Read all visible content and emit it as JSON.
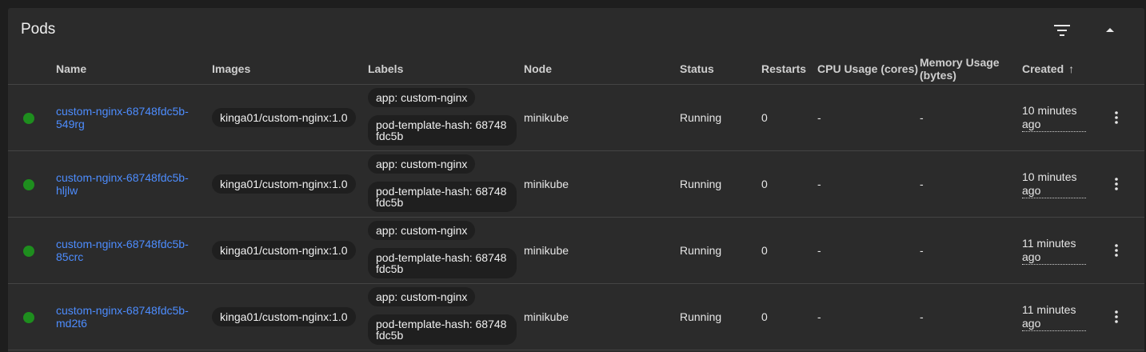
{
  "card": {
    "title": "Pods"
  },
  "icons": {
    "filter": "filter-list-icon",
    "collapse": "chevron-up-icon",
    "menu": "more-vert-icon",
    "status": "status-running-dot"
  },
  "columns": {
    "name": "Name",
    "images": "Images",
    "labels": "Labels",
    "node": "Node",
    "status": "Status",
    "restarts": "Restarts",
    "cpu": "CPU Usage (cores)",
    "memory": "Memory Usage (bytes)",
    "created": "Created",
    "created_sort": "↑"
  },
  "colors": {
    "link": "#4d8dff",
    "running": "#1e8e1e"
  },
  "rows": [
    {
      "name": "custom-nginx-68748fdc5b-549rg",
      "image": "kinga01/custom-nginx:1.0",
      "label_app": "app: custom-nginx",
      "label_hash": "pod-template-hash: 68748fdc5b",
      "node": "minikube",
      "status": "Running",
      "restarts": "0",
      "cpu": "-",
      "memory": "-",
      "created": "10 minutes ago"
    },
    {
      "name": "custom-nginx-68748fdc5b-hljlw",
      "image": "kinga01/custom-nginx:1.0",
      "label_app": "app: custom-nginx",
      "label_hash": "pod-template-hash: 68748fdc5b",
      "node": "minikube",
      "status": "Running",
      "restarts": "0",
      "cpu": "-",
      "memory": "-",
      "created": "10 minutes ago"
    },
    {
      "name": "custom-nginx-68748fdc5b-85crc",
      "image": "kinga01/custom-nginx:1.0",
      "label_app": "app: custom-nginx",
      "label_hash": "pod-template-hash: 68748fdc5b",
      "node": "minikube",
      "status": "Running",
      "restarts": "0",
      "cpu": "-",
      "memory": "-",
      "created": "11 minutes ago"
    },
    {
      "name": "custom-nginx-68748fdc5b-md2t6",
      "image": "kinga01/custom-nginx:1.0",
      "label_app": "app: custom-nginx",
      "label_hash": "pod-template-hash: 68748fdc5b",
      "node": "minikube",
      "status": "Running",
      "restarts": "0",
      "cpu": "-",
      "memory": "-",
      "created": "11 minutes ago"
    }
  ]
}
